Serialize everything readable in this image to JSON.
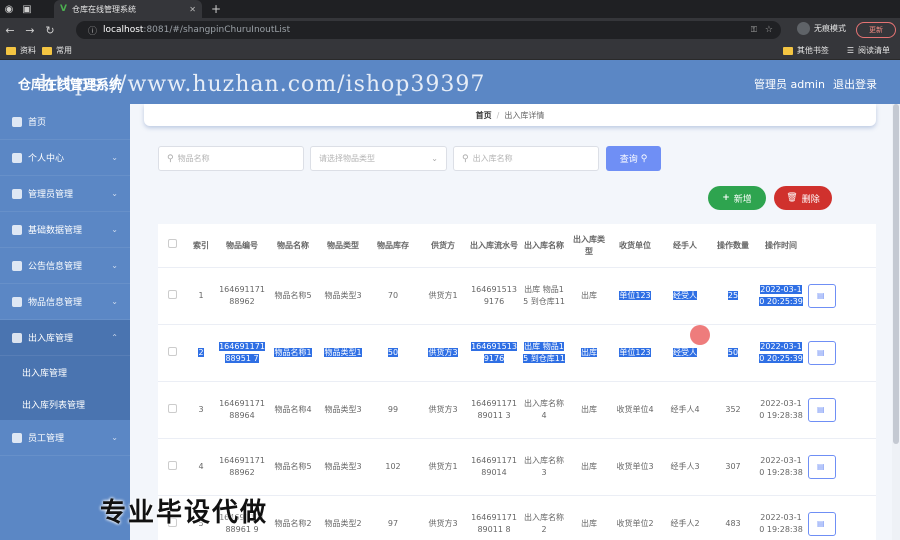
{
  "browser": {
    "tab_title": "仓库在线管理系统",
    "url_host": "localhost",
    "url_path": ":8081/#/shangpinChuruInoutList",
    "incognito_label": "无痕模式",
    "update_label": "更新",
    "bookmarks": [
      "资料",
      "常用"
    ],
    "bookmarks_right": [
      "其他书签",
      "阅读清单"
    ]
  },
  "header": {
    "title": "仓库在线管理系统",
    "admin_label": "管理员 admin",
    "logout_label": "退出登录",
    "watermark": "https://www.huzhan.com/ishop39397"
  },
  "sidebar": {
    "items": [
      {
        "label": "首页",
        "icon": "home-icon"
      },
      {
        "label": "个人中心",
        "icon": "user-icon"
      },
      {
        "label": "管理员管理",
        "icon": "admin-icon"
      },
      {
        "label": "基础数据管理",
        "icon": "data-icon"
      },
      {
        "label": "公告信息管理",
        "icon": "notice-icon"
      },
      {
        "label": "物品信息管理",
        "icon": "goods-icon"
      },
      {
        "label": "出入库管理",
        "icon": "inout-icon"
      }
    ],
    "sub_items": [
      "出入库管理",
      "出入库列表管理"
    ],
    "last_item": {
      "label": "员工管理",
      "icon": "staff-icon"
    }
  },
  "breadcrumb": {
    "home": "首页",
    "current": "出入库详情"
  },
  "search": {
    "name_placeholder": "物品名称",
    "type_placeholder": "请选择物品类型",
    "inout_placeholder": "出入库名称",
    "query_label": "查询"
  },
  "actions": {
    "add_label": "新增",
    "delete_label": "删除"
  },
  "table": {
    "headers": [
      "",
      "索引",
      "物品编号",
      "物品名称",
      "物品类型",
      "物品库存",
      "供货方",
      "出入库流水号",
      "出入库名称",
      "出入库类型",
      "收货单位",
      "经手人",
      "操作数量",
      "操作时间",
      ""
    ],
    "rows": [
      {
        "cells": [
          "",
          "1",
          "16469117188962",
          "物品名称5",
          "物品类型3",
          "70",
          "供货方1",
          "1646915139176",
          "出库 物品1 5 到仓库11",
          "出库",
          "单位123",
          "经受人",
          "25",
          "2022-03-10 20:25:39"
        ],
        "selected": false
      },
      {
        "cells": [
          "",
          "2",
          "16469117188951 7",
          "物品名称1",
          "物品类型1",
          "50",
          "供货方3",
          "1646915139176",
          "出库 物品1 5 到仓库11",
          "出库",
          "单位123",
          "经受人",
          "50",
          "2022-03-10 20:25:39"
        ],
        "selected": true
      },
      {
        "cells": [
          "",
          "3",
          "16469117188964",
          "物品名称4",
          "物品类型3",
          "99",
          "供货方3",
          "16469117189011 3",
          "出入库名称4",
          "出库",
          "收货单位4",
          "经手人4",
          "352",
          "2022-03-10 19:28:38"
        ],
        "selected": false
      },
      {
        "cells": [
          "",
          "4",
          "16469117188962",
          "物品名称5",
          "物品类型3",
          "102",
          "供货方1",
          "16469117189014",
          "出入库名称3",
          "出库",
          "收货单位3",
          "经手人3",
          "307",
          "2022-03-10 19:28:38"
        ],
        "selected": false
      },
      {
        "cells": [
          "",
          "5",
          "16469117188961 9",
          "物品名称2",
          "物品类型2",
          "97",
          "供货方3",
          "16469117189011 8",
          "出入库名称2",
          "出库",
          "收货单位2",
          "经手人2",
          "483",
          "2022-03-10 19:28:38"
        ],
        "selected": false
      }
    ],
    "row_action_label": "详"
  },
  "bottom_watermark": "专业毕设代做"
}
